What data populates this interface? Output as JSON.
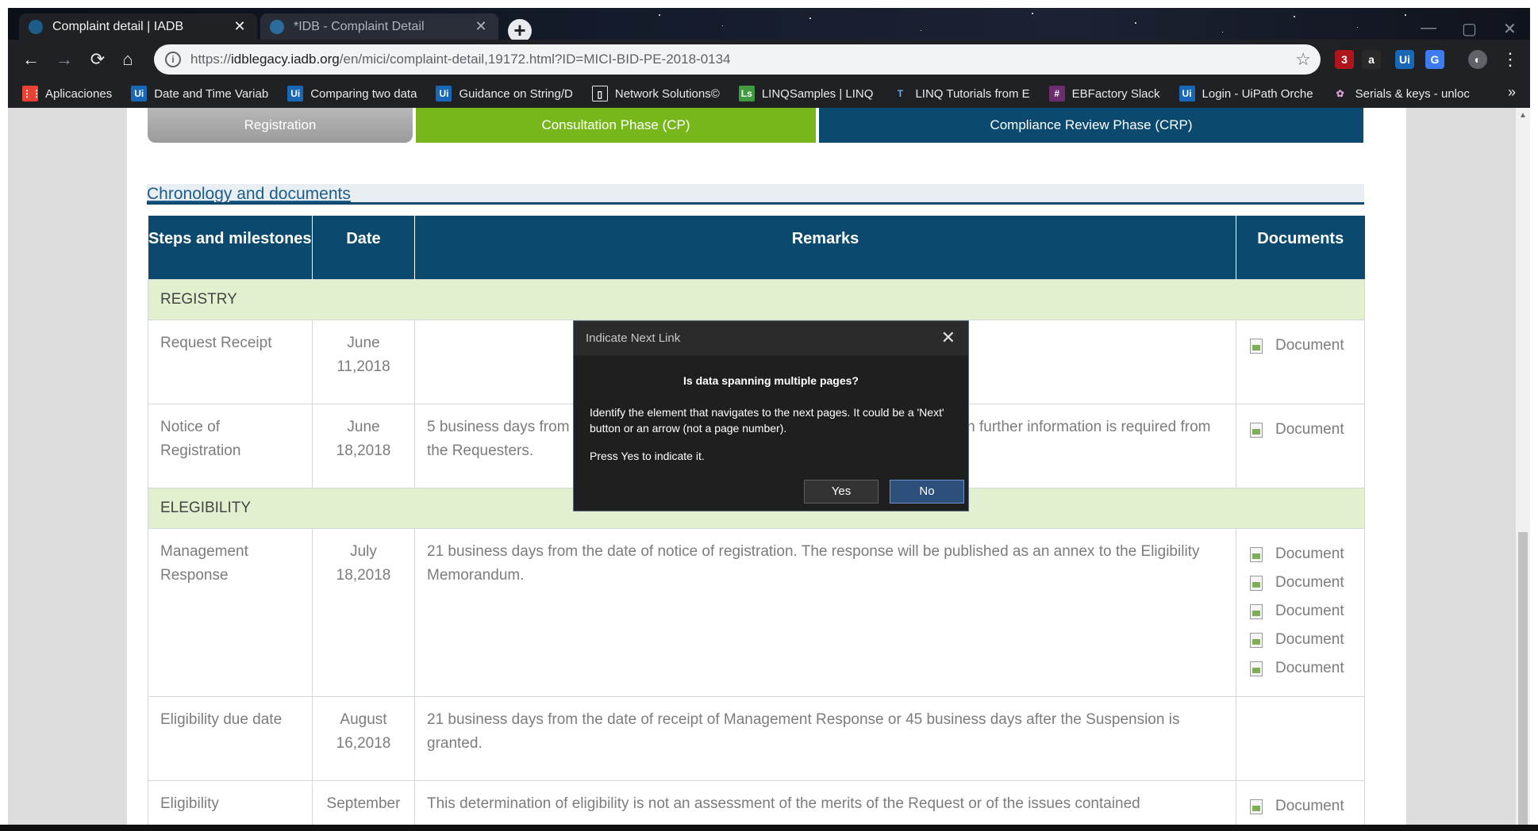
{
  "browser": {
    "tabs": [
      {
        "title": "Complaint detail | IADB",
        "close": "✕",
        "active": true
      },
      {
        "title": "*IDB - Complaint Detail",
        "close": "✕",
        "active": false
      }
    ],
    "new_tab": "+",
    "window_controls": [
      "—",
      "▢",
      "✕"
    ],
    "url": {
      "scheme": "https://",
      "host": "idblegacy.iadb.org",
      "path": "/en/mici/complaint-detail,19172.html?ID=MICI-BID-PE-2018-0134"
    },
    "extensions": [
      {
        "name": "ublock-icon",
        "label": "3",
        "color": "#b0151c"
      },
      {
        "name": "amazon-icon",
        "label": "a",
        "color": "#2a2a2a"
      },
      {
        "name": "uipath-icon",
        "label": "Ui",
        "color": "#1868b7"
      },
      {
        "name": "translate-icon",
        "label": "G",
        "color": "#3d7cf0"
      },
      {
        "name": "profile-icon",
        "label": "◐",
        "color": "#5f6368"
      }
    ],
    "menu": "⋮"
  },
  "bookmarks": [
    {
      "label": "Aplicaciones",
      "icon": "apps-grid-icon",
      "color": "#e94235",
      "glyph": "⋮⋮"
    },
    {
      "label": "Date and Time Variab",
      "icon": "uipath-icon",
      "color": "#1868b7",
      "glyph": "Ui"
    },
    {
      "label": "Comparing two data",
      "icon": "uipath-icon",
      "color": "#1868b7",
      "glyph": "Ui"
    },
    {
      "label": "Guidance on String/D",
      "icon": "uipath-icon",
      "color": "#1868b7",
      "glyph": "Ui"
    },
    {
      "label": "Network Solutions©",
      "icon": "page-icon",
      "color": "#202124",
      "glyph": "▯"
    },
    {
      "label": "LINQSamples | LINQ",
      "icon": "linqsamples-icon",
      "color": "#3e9c3e",
      "glyph": "Ls"
    },
    {
      "label": "LINQ Tutorials from E",
      "icon": "linq-tutorials-icon",
      "color": "#202124",
      "glyph": "T"
    },
    {
      "label": "EBFactory Slack",
      "icon": "slack-icon",
      "color": "#6b2d6f",
      "glyph": "#"
    },
    {
      "label": "Login - UiPath Orche",
      "icon": "uipath-icon",
      "color": "#1868b7",
      "glyph": "Ui"
    },
    {
      "label": "Serials & keys - unloc",
      "icon": "serials-icon",
      "color": "#202124",
      "glyph": "✿"
    }
  ],
  "bookmarks_more": "»",
  "phases": {
    "registration": "Registration",
    "cp": "Consultation Phase (CP)",
    "crp": "Compliance Review Phase (CRP)"
  },
  "section_title": "Chronology and documents",
  "table": {
    "headers": [
      "Steps and milestones",
      "Date",
      "Remarks",
      "Documents"
    ],
    "doc_label": "Document",
    "groups": [
      {
        "name": "REGISTRY",
        "rows": [
          {
            "step": "Request Receipt",
            "date": "June 11,2018",
            "remarks": "",
            "docs": 1
          },
          {
            "step": "Notice of Registration",
            "date": "June 18,2018",
            "remarks": "5 business days from the date of receipt of the Request or 10 business days when further information is required from the Requesters.",
            "docs": 1
          }
        ]
      },
      {
        "name": "ELEGIBILITY",
        "rows": [
          {
            "step": "Management Response",
            "date": "July 18,2018",
            "remarks": "21 business days from the date of notice of registration. The response will be published as an annex to the Eligibility Memorandum.",
            "docs": 5
          },
          {
            "step": "Eligibility due date",
            "date": "August 16,2018",
            "remarks": "21 business days from the date of receipt of Management Response or 45 business days after the Suspension is granted.",
            "docs": 0
          },
          {
            "step": "Eligibility",
            "date": "September",
            "remarks": "This determination of eligibility is not an assessment of the merits of the Request or of the issues contained",
            "docs": 1
          }
        ]
      }
    ]
  },
  "dialog": {
    "title": "Indicate Next Link",
    "close": "✕",
    "question": "Is data spanning multiple pages?",
    "body": "Identify the element that navigates to the next pages. It could be a 'Next' button or an arrow (not a page number).",
    "note": "Press Yes to indicate it.",
    "yes": "Yes",
    "no": "No"
  }
}
